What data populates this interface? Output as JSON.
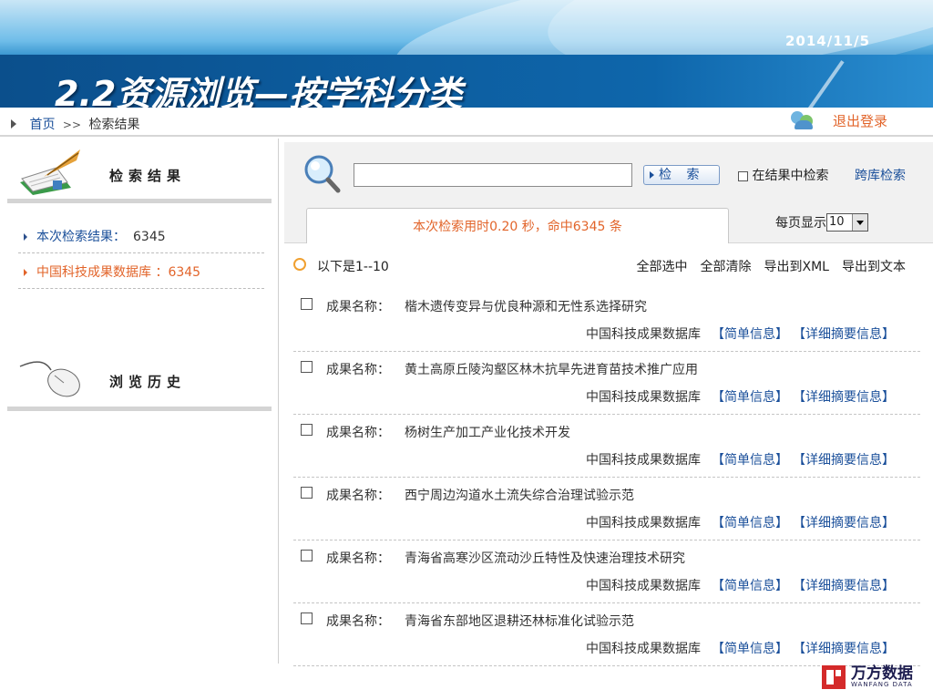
{
  "slide": {
    "date": "2014/11/5",
    "title": "2.2资源浏览—按学科分类"
  },
  "breadcrumb": {
    "home": "首页",
    "separator": ">>",
    "current": "检索结果"
  },
  "logout": {
    "label": "退出登录",
    "icon": "users-icon"
  },
  "sidebar": {
    "results_title": "检索结果",
    "results_icon": "notebook-quill-icon",
    "rows": [
      {
        "label": "本次检索结果：",
        "count": "6345",
        "color": "#1a4f9a"
      },
      {
        "label": "中国科技成果数据库 ：",
        "count": "6345",
        "color": "#e2642a"
      }
    ],
    "history_title": "浏览历史",
    "history_icon": "mouse-icon"
  },
  "search": {
    "icon": "magnifier-icon",
    "input_value": "",
    "button_label": "检  索",
    "within_label": "在结果中检索",
    "cross_label": "跨库检索"
  },
  "stats": {
    "summary": "本次检索用时0.20 秒，命中6345 条",
    "per_page_label": "每页显示",
    "per_page_value": "10"
  },
  "list": {
    "range": "以下是1--10",
    "ops": [
      "全部选中",
      "全部清除",
      "导出到XML",
      "导出到文本"
    ],
    "field_label": "成果名称：",
    "db_label": "中国科技成果数据库",
    "link_simple": "【简单信息】",
    "link_detail": "【详细摘要信息】",
    "items": [
      {
        "name": "楷木遗传变异与优良种源和无性系选择研究"
      },
      {
        "name": "黄土高原丘陵沟壑区林木抗旱先进育苗技术推广应用"
      },
      {
        "name": "杨树生产加工产业化技术开发"
      },
      {
        "name": "西宁周边沟道水土流失综合治理试验示范"
      },
      {
        "name": "青海省高寒沙区流动沙丘特性及快速治理技术研究"
      },
      {
        "name": "青海省东部地区退耕还林标准化试验示范"
      }
    ]
  },
  "brand": {
    "name": "万方数据",
    "sub": "WANFANG DATA"
  },
  "colors": {
    "link": "#1a4f9a",
    "accent": "#e2642a",
    "banner": "#0e66ab"
  }
}
